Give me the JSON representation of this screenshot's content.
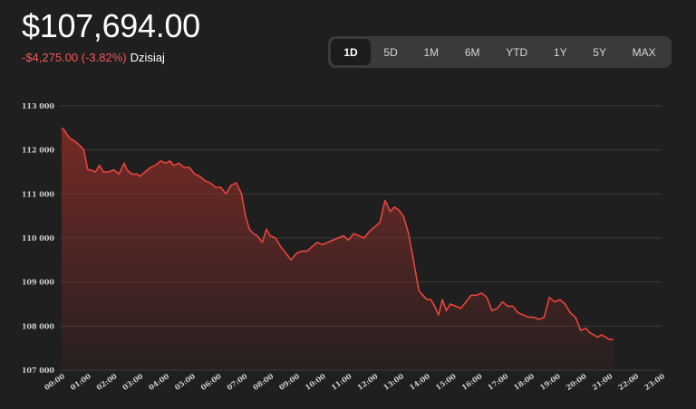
{
  "header": {
    "price": "$107,694.00",
    "change": "-$4,275.00 (-3.82%)",
    "period_label": "Dzisiaj"
  },
  "ranges": [
    {
      "label": "1D",
      "active": true
    },
    {
      "label": "5D",
      "active": false
    },
    {
      "label": "1M",
      "active": false
    },
    {
      "label": "6M",
      "active": false
    },
    {
      "label": "YTD",
      "active": false
    },
    {
      "label": "1Y",
      "active": false
    },
    {
      "label": "5Y",
      "active": false
    },
    {
      "label": "MAX",
      "active": false
    }
  ],
  "colors": {
    "line": "#e8453c",
    "fill_top": "#7a2b27",
    "background": "#1f1f1f",
    "grid": "#3b3b3b",
    "negative": "#f25757"
  },
  "chart_data": {
    "type": "area",
    "title": "",
    "xlabel": "",
    "ylabel": "",
    "ylim": [
      107000,
      113000
    ],
    "xlim": [
      0,
      23
    ],
    "grid": "horizontal",
    "y_ticks": [
      "107 000",
      "108 000",
      "109 000",
      "110 000",
      "111 000",
      "112 000",
      "113 000"
    ],
    "y_tick_values": [
      107000,
      108000,
      109000,
      110000,
      111000,
      112000,
      113000
    ],
    "x_ticks": [
      "00:00",
      "01:00",
      "02:00",
      "03:00",
      "04:00",
      "05:00",
      "06:00",
      "07:00",
      "08:00",
      "09:00",
      "10:00",
      "11:00",
      "12:00",
      "13:00",
      "14:00",
      "15:00",
      "16:00",
      "17:00",
      "18:00",
      "19:00",
      "20:00",
      "21:00",
      "22:00",
      "23:00"
    ],
    "series": [
      {
        "x": [
          0,
          0.1,
          0.2,
          0.35,
          0.5,
          0.7,
          0.85,
          1.0,
          1.1,
          1.3,
          1.45,
          1.6,
          1.8,
          2.0,
          2.2,
          2.4,
          2.5,
          2.7,
          2.9,
          3.0,
          3.2,
          3.4,
          3.6,
          3.8,
          4.0,
          4.15,
          4.3,
          4.5,
          4.7,
          4.9,
          5.1,
          5.3,
          5.5,
          5.7,
          5.9,
          6.1,
          6.3,
          6.5,
          6.7,
          6.9,
          7.05,
          7.2,
          7.35,
          7.5,
          7.7,
          7.85,
          8.0,
          8.2,
          8.4,
          8.6,
          8.8,
          9.0,
          9.2,
          9.4,
          9.6,
          9.8,
          10.0,
          10.2,
          10.4,
          10.6,
          10.8,
          11.0,
          11.2,
          11.4,
          11.6,
          11.8,
          12.0,
          12.2,
          12.4,
          12.6,
          12.75,
          12.9,
          13.1,
          13.3,
          13.5,
          13.7,
          13.85,
          14.0,
          14.15,
          14.3,
          14.45,
          14.6,
          14.75,
          14.9,
          15.1,
          15.3,
          15.5,
          15.7,
          15.9,
          16.1,
          16.3,
          16.5,
          16.7,
          16.9,
          17.1,
          17.3,
          17.5,
          17.7,
          17.9,
          18.1,
          18.3,
          18.5,
          18.7,
          18.9,
          19.1,
          19.3,
          19.5,
          19.7,
          19.9,
          20.1,
          20.25,
          20.4,
          20.55,
          20.7,
          20.85,
          21.0,
          21.15
        ],
        "values": [
          112500,
          112450,
          112350,
          112250,
          112200,
          112100,
          112000,
          111550,
          111550,
          111500,
          111650,
          111500,
          111500,
          111550,
          111450,
          111700,
          111550,
          111450,
          111450,
          111400,
          111500,
          111600,
          111650,
          111750,
          111700,
          111750,
          111650,
          111700,
          111600,
          111600,
          111450,
          111400,
          111300,
          111250,
          111150,
          111150,
          111000,
          111200,
          111250,
          111000,
          110500,
          110200,
          110100,
          110050,
          109900,
          110200,
          110050,
          110000,
          109800,
          109650,
          109500,
          109650,
          109700,
          109700,
          109800,
          109900,
          109850,
          109900,
          109950,
          110000,
          110050,
          109950,
          110100,
          110050,
          110000,
          110150,
          110250,
          110350,
          110850,
          110600,
          110700,
          110650,
          110500,
          110100,
          109450,
          108800,
          108700,
          108600,
          108600,
          108450,
          108250,
          108600,
          108350,
          108500,
          108450,
          108400,
          108550,
          108700,
          108700,
          108750,
          108650,
          108350,
          108400,
          108550,
          108450,
          108450,
          108300,
          108250,
          108200,
          108200,
          108150,
          108200,
          108650,
          108550,
          108600,
          108500,
          108300,
          108200,
          107900,
          107950,
          107850,
          107800,
          107750,
          107800,
          107750,
          107694,
          107694
        ]
      }
    ]
  }
}
